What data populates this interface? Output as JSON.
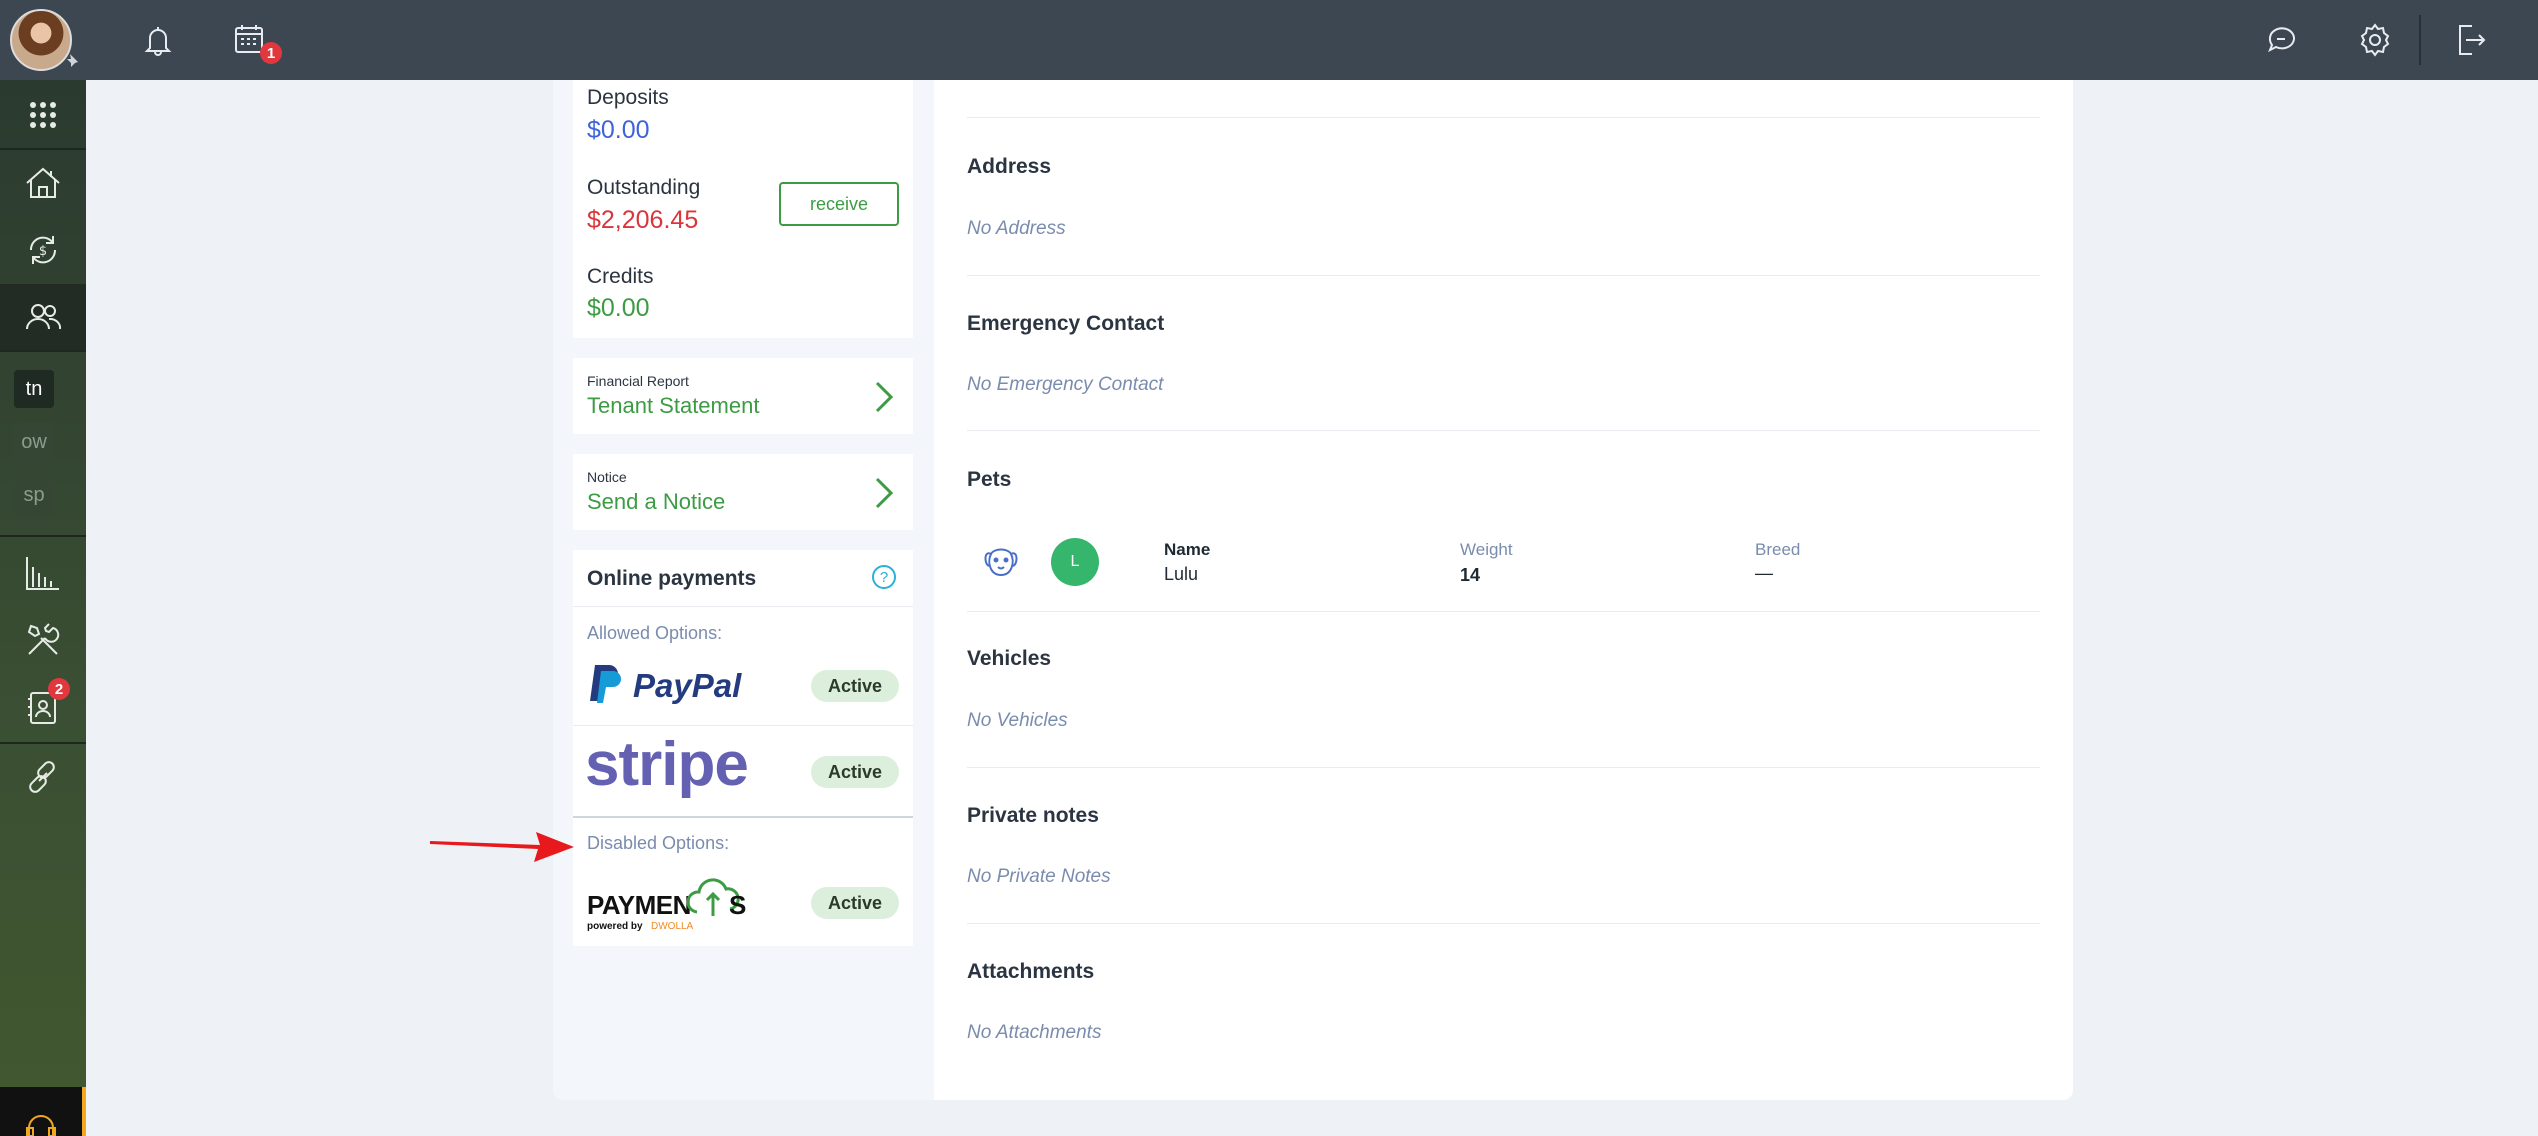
{
  "topbar": {
    "calendar_badge": "1",
    "icons": [
      "bell-icon",
      "calendar-icon",
      "chat-icon",
      "gear-icon",
      "logout-icon"
    ]
  },
  "sidebar": {
    "items": [
      {
        "icon": "apps-grid-icon"
      },
      {
        "icon": "property-house-icon"
      },
      {
        "icon": "money-cycle-icon"
      },
      {
        "icon": "people-icon",
        "active": true
      },
      {
        "text": "tn"
      },
      {
        "text": "ow"
      },
      {
        "text": "sp"
      },
      {
        "icon": "bar-chart-icon"
      },
      {
        "icon": "tools-icon"
      },
      {
        "icon": "contacts-icon",
        "badge": "2"
      },
      {
        "icon": "link-icon"
      },
      {
        "icon": "headset-icon"
      }
    ]
  },
  "balances": {
    "deposits_label": "Deposits",
    "deposits_value": "$0.00",
    "outstanding_label": "Outstanding",
    "outstanding_value": "$2,206.45",
    "receive_label": "receive",
    "credits_label": "Credits",
    "credits_value": "$0.00"
  },
  "financial_report": {
    "small_label": "Financial Report",
    "link": "Tenant Statement"
  },
  "notice": {
    "small_label": "Notice",
    "link": "Send a Notice"
  },
  "online_payments": {
    "title": "Online payments",
    "help": "?",
    "allowed_label": "Allowed Options:",
    "disabled_label": "Disabled Options:",
    "paypal_logo": "PayPal",
    "stripe_logo": "stripe",
    "payments_logo_1": "PAYMEN",
    "payments_logo_2": "S",
    "payments_powered": "powered by",
    "payments_brand": "DWOLLA",
    "status": [
      "Active",
      "Active",
      "Active"
    ]
  },
  "details": {
    "address_title": "Address",
    "address_empty": "No Address",
    "emergency_title": "Emergency Contact",
    "emergency_empty": "No Emergency Contact",
    "pets_title": "Pets",
    "pet": {
      "initial": "L",
      "name_label": "Name",
      "name_value": "Lulu",
      "weight_label": "Weight",
      "weight_value": "14",
      "breed_label": "Breed",
      "breed_value": "—"
    },
    "vehicles_title": "Vehicles",
    "vehicles_empty": "No Vehicles",
    "notes_title": "Private notes",
    "notes_empty": "No Private Notes",
    "attachments_title": "Attachments",
    "attachments_empty": "No Attachments"
  },
  "colors": {
    "accent_green": "#3c9c44",
    "deposit_blue": "#3f63d8",
    "outstanding_red": "#d8363a",
    "topbar": "#3d4752",
    "arrow_red": "#e8191c"
  }
}
